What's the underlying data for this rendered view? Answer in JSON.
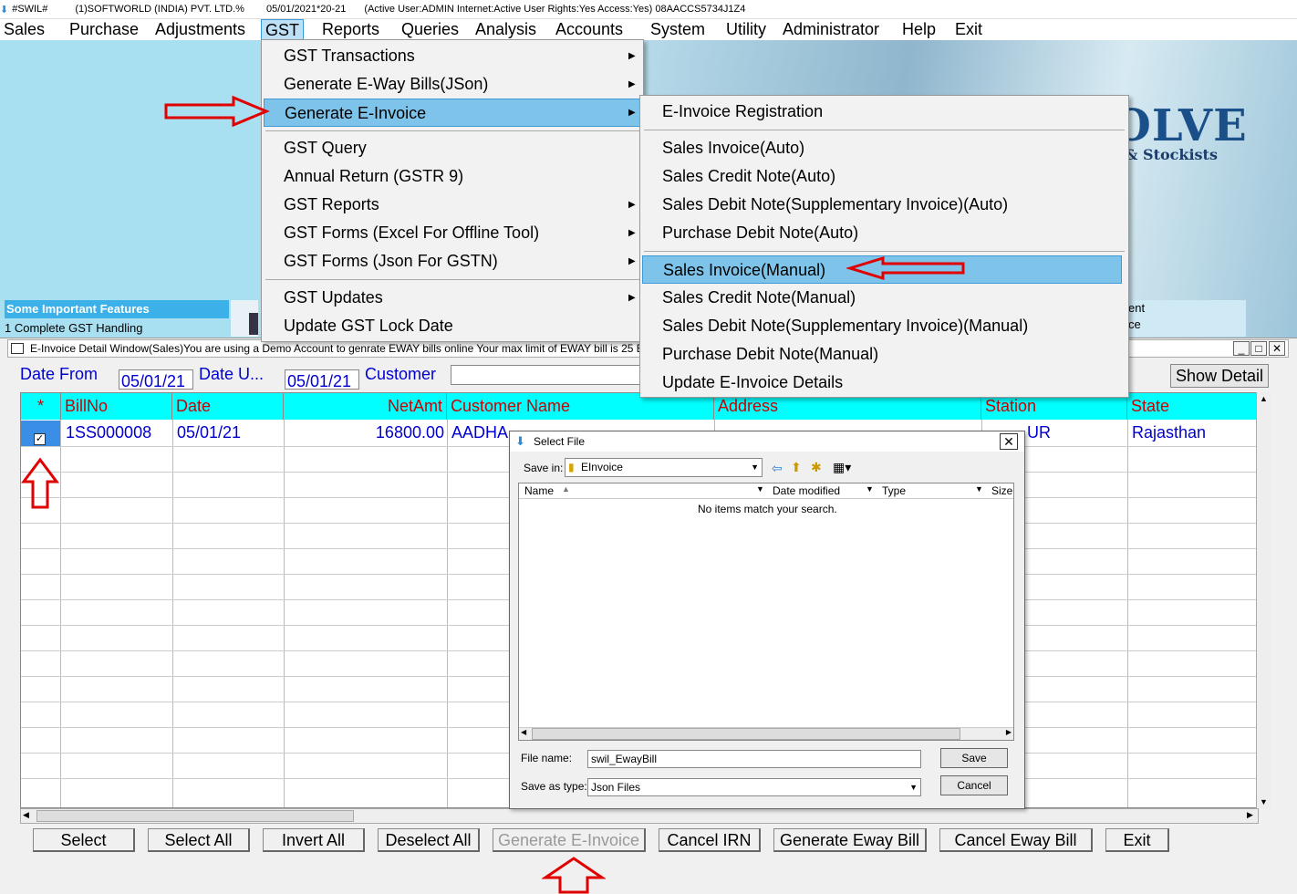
{
  "titlebar": {
    "app": "#SWIL#",
    "company": "(1)SOFTWORLD (INDIA) PVT. LTD.%",
    "date": "05/01/2021*20-21",
    "status": "(Active User:ADMIN Internet:Active  User Rights:Yes Access:Yes) 08AACCS5734J1Z4"
  },
  "menubar": [
    "Sales",
    "Purchase",
    "Adjustments",
    "GST",
    "Reports",
    "Queries",
    "Analysis",
    "Accounts",
    "System",
    "Utility",
    "Administrator",
    "Help",
    "Exit"
  ],
  "background": {
    "brand_main": "OLVE",
    "brand_sub": "rs & Stockists",
    "features_title": "Some Important Features",
    "features_line": "1 Complete GST Handling",
    "right_text1": "ent",
    "right_text2": "ce"
  },
  "gst_menu": [
    {
      "label": "GST Transactions",
      "submenu": true
    },
    {
      "label": "Generate E-Way Bills(JSon)",
      "submenu": true
    },
    {
      "label": "Generate E-Invoice",
      "submenu": true,
      "highlighted": true
    },
    {
      "label": "GST Query",
      "submenu": false
    },
    {
      "label": "Annual Return (GSTR 9)",
      "submenu": false
    },
    {
      "label": "GST Reports",
      "submenu": true
    },
    {
      "label": "GST Forms (Excel For Offline Tool)",
      "submenu": true
    },
    {
      "label": "GST Forms (Json For GSTN)",
      "submenu": true
    },
    {
      "label": "GST Updates",
      "submenu": true
    },
    {
      "label": "Update GST Lock Date",
      "submenu": false
    }
  ],
  "einvoice_submenu": [
    {
      "label": "E-Invoice Registration"
    },
    {
      "label": "Sales Invoice(Auto)"
    },
    {
      "label": "Sales Credit Note(Auto)"
    },
    {
      "label": "Sales Debit Note(Supplementary Invoice)(Auto)"
    },
    {
      "label": "Purchase Debit Note(Auto)"
    },
    {
      "label": "Sales Invoice(Manual)",
      "highlighted": true
    },
    {
      "label": "Sales Credit Note(Manual)"
    },
    {
      "label": "Sales Debit Note(Supplementary Invoice)(Manual)"
    },
    {
      "label": "Purchase Debit Note(Manual)"
    },
    {
      "label": "Update E-Invoice Details"
    }
  ],
  "window": {
    "title": "E-Invoice Detail Window(Sales)You are using a Demo Account to genrate EWAY bills online Your max limit of EWAY bill is 25 Bil",
    "date_from_label": "Date From",
    "date_from_value": "05/01/21",
    "date_upto_label": "Date U...",
    "date_upto_value": "05/01/21",
    "customer_label": "Customer",
    "customer_value": "",
    "show_detail": "Show Detail",
    "columns": [
      "*",
      "BillNo",
      "Date",
      "NetAmt",
      "Customer Name",
      "Address",
      "Station",
      "State"
    ],
    "rows": [
      {
        "checked": true,
        "billno": "1SS000008",
        "date": "05/01/21",
        "netamt": "16800.00",
        "customer": "AADHA",
        "address": "",
        "station": "UR",
        "state": "Rajasthan"
      }
    ],
    "buttons": [
      "Select",
      "Select All",
      "Invert All",
      "Deselect All",
      "Generate E-Invoice",
      "Cancel IRN",
      "Generate Eway Bill",
      "Cancel Eway Bill",
      "Exit"
    ]
  },
  "dialog": {
    "title": "Select File",
    "save_in_label": "Save in:",
    "save_in_value": "EInvoice",
    "col_name": "Name",
    "col_date": "Date modified",
    "col_type": "Type",
    "col_size": "Size",
    "empty_msg": "No items match your search.",
    "filename_label": "File name:",
    "filename_value": "swil_EwayBill",
    "filetype_label": "Save as type:",
    "filetype_value": "Json Files",
    "save_btn": "Save",
    "cancel_btn": "Cancel"
  },
  "colors": {
    "accent": "#0000d0",
    "header_bg": "#00ffff",
    "header_text": "#cc0000",
    "highlight": "#7ec4ea",
    "arrow": "#e00000"
  }
}
